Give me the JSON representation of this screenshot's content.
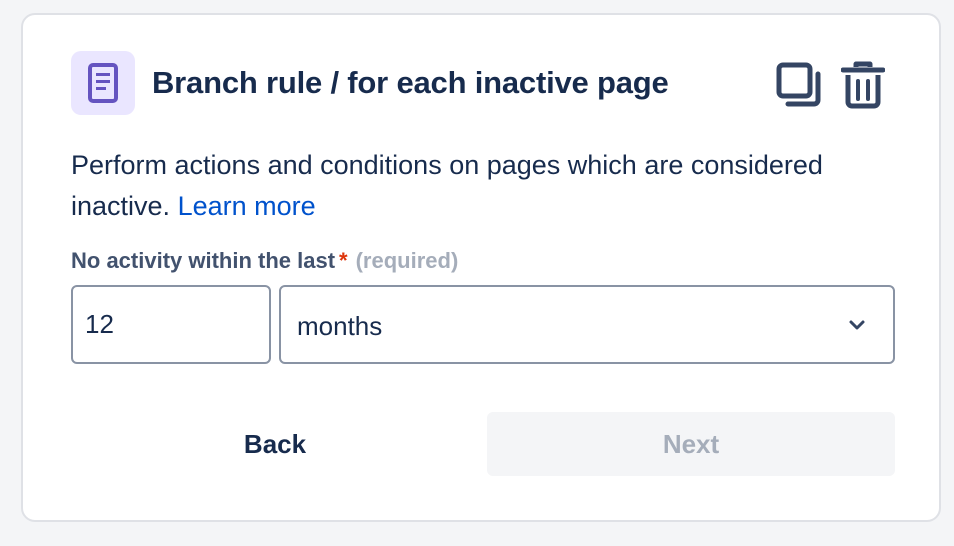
{
  "rule": {
    "title": "Branch rule / for each inactive page",
    "icon": "page-document-icon",
    "accent_color": "#6554c0",
    "icon_bg_color": "#eae6ff"
  },
  "actions": {
    "copy_icon": "copy-icon",
    "delete_icon": "trash-icon"
  },
  "description": {
    "text": "Perform actions and conditions on pages which are considered inactive.",
    "link_label": "Learn more",
    "link_color": "#0052cc"
  },
  "field": {
    "label": "No activity within the last",
    "required_marker": "*",
    "required_text": "(required)",
    "amount_value": "12",
    "unit_value": "months",
    "unit_icon": "chevron-down-icon"
  },
  "footer": {
    "back_label": "Back",
    "next_label": "Next"
  }
}
